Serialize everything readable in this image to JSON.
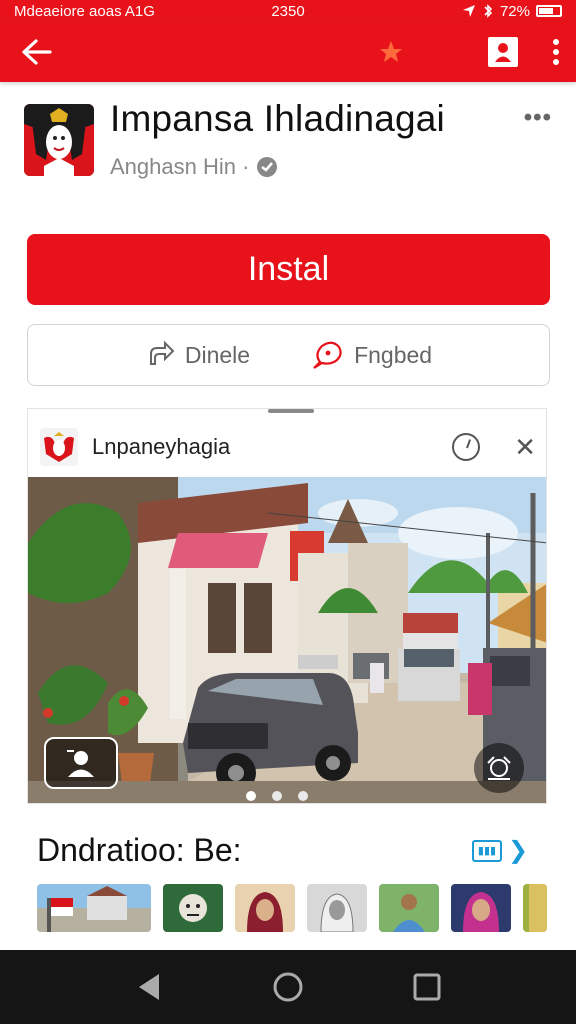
{
  "status_bar": {
    "carrier": "Mdeaeiore aoas  A1G",
    "time": "2350",
    "battery": "72%"
  },
  "app_bar": {
    "back_icon": "arrow-left-icon",
    "star_icon": "star-icon",
    "account_icon": "account-icon",
    "more_icon": "more-vert-icon"
  },
  "app": {
    "title": "Impansa  Ihladinagai",
    "subtitle": "Anghasn Hin ·",
    "install_label": "Instal",
    "actions": [
      {
        "label": "Dinele",
        "icon": "share-icon"
      },
      {
        "label": "Fngbed",
        "icon": "flag-icon"
      }
    ]
  },
  "preview_card": {
    "title": "Lnpaneyhagia",
    "dots": 3,
    "active_dot": 0
  },
  "section": {
    "title": "Dndratioo: Be:"
  },
  "colors": {
    "brand_red": "#e8121a",
    "link_blue": "#1a9ad6"
  }
}
